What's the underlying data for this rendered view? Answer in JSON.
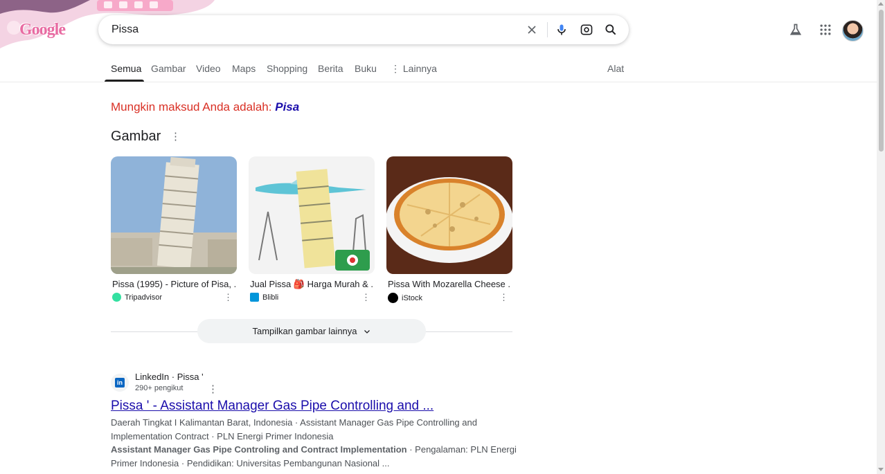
{
  "header": {
    "logo_text": "Google",
    "search_value": "Pissa"
  },
  "tabs": {
    "items": [
      "Semua",
      "Gambar",
      "Video",
      "Maps",
      "Shopping",
      "Berita",
      "Buku",
      "Lainnya"
    ],
    "active": "Semua",
    "tools_label": "Alat"
  },
  "did_you_mean": {
    "prefix": "Mungkin maksud Anda adalah:",
    "suggestion": "Pisa"
  },
  "images_section": {
    "title": "Gambar",
    "cards": [
      {
        "title": "Pissa (1995) - Picture of Pisa, ...",
        "source": "Tripadvisor",
        "source_color": "#34e0a1"
      },
      {
        "title": "Jual Pissa 🎒 Harga Murah & ...",
        "source": "Blibli",
        "source_color": "#0095da"
      },
      {
        "title": "Pissa With Mozarella Cheese ...",
        "source": "iStock",
        "source_color": "#000000"
      }
    ],
    "more_button": "Tampilkan gambar lainnya"
  },
  "result": {
    "site": "LinkedIn · Pissa '",
    "followers": "290+ pengikut",
    "title": "Pissa ' - Assistant Manager Gas Pipe Controlling and ...",
    "line1": "Daerah Tingkat I Kalimantan Barat, Indonesia · Assistant Manager Gas Pipe Controlling and",
    "line2": "Implementation Contract · PLN Energi Primer Indonesia",
    "line3_bold": "Assistant Manager Gas Pipe Controling and Contract Implementation",
    "line3_rest": " · Pengalaman: PLN Energi",
    "line4": "Primer Indonesia · Pendidikan: Universitas Pembangunan Nasional ..."
  },
  "colors": {
    "link": "#1a0dab",
    "did_you_mean": "#d93025",
    "accent_pink": "#e86ba2"
  }
}
